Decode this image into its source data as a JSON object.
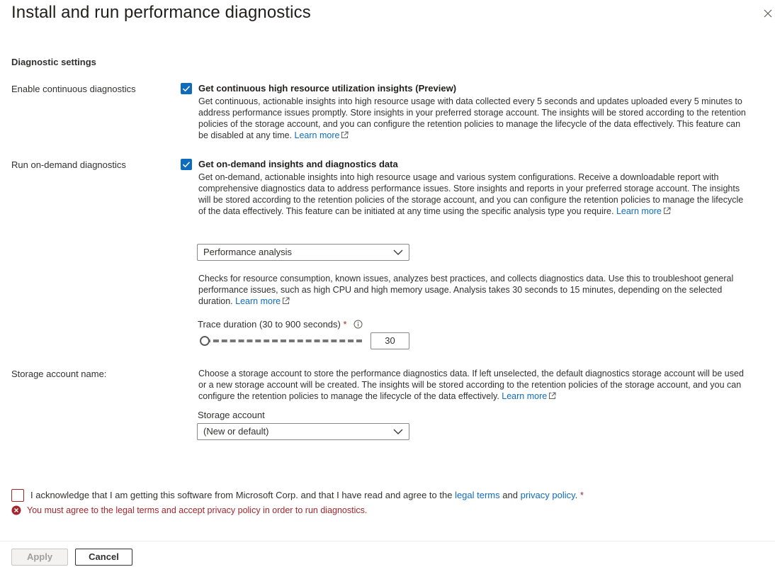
{
  "header": {
    "title": "Install and run performance diagnostics"
  },
  "section": {
    "title": "Diagnostic settings"
  },
  "continuous": {
    "label": "Enable continuous diagnostics",
    "checked": true,
    "option_title": "Get continuous high resource utilization insights (Preview)",
    "description": "Get continuous, actionable insights into high resource usage with data collected every 5 seconds and updates uploaded every 5 minutes to address performance issues promptly. Store insights in your preferred storage account. The insights will be stored according to the retention policies of the storage account, and you can configure the retention policies to manage the lifecycle of the data effectively. This feature can be disabled at any time.",
    "learn_more": "Learn more"
  },
  "ondemand": {
    "label": "Run on-demand diagnostics",
    "checked": true,
    "option_title": "Get on-demand insights and diagnostics data",
    "description": "Get on-demand, actionable insights into high resource usage and various system configurations. Receive a downloadable report with comprehensive diagnostics data to address performance issues. Store insights and reports in your preferred storage account. The insights will be stored according to the retention policies of the storage account, and you can configure the retention policies to manage the lifecycle of the data effectively. This feature can be initiated at any time using the specific analysis type you require.",
    "learn_more_1": "Learn",
    "learn_more_2": "more",
    "analysis_type": "Performance analysis",
    "analysis_description": "Checks for resource consumption, known issues, analyzes best practices, and collects diagnostics data. Use this to troubleshoot general performance issues, such as high CPU and high memory usage. Analysis takes 30 seconds to 15 minutes, depending on the selected duration.",
    "analysis_learn_more": "Learn more",
    "trace_label": "Trace duration (30 to 900 seconds)",
    "trace_required": "*",
    "trace_value": "30",
    "trace_min": 30,
    "trace_max": 900
  },
  "storage": {
    "label": "Storage account name:",
    "description": "Choose a storage account to store the performance diagnostics data. If left unselected, the default diagnostics storage account will be used or a new storage account will be created. The insights will be stored according to the retention policies of the storage account, and you can configure the retention policies to manage the lifecycle of the data effectively.",
    "learn_more": "Learn more",
    "field_label": "Storage account",
    "value": "(New or default)"
  },
  "acknowledge": {
    "checked": false,
    "text_before": "I acknowledge that I am getting this software from Microsoft Corp. and that I have read and agree to the",
    "legal_terms": "legal terms",
    "and": "and",
    "privacy_policy": "privacy policy",
    "suffix": ".",
    "required": "*",
    "error": "You must agree to the legal terms and accept privacy policy in order to run diagnostics."
  },
  "footer": {
    "apply": "Apply",
    "cancel": "Cancel"
  },
  "colors": {
    "accent": "#0f6cbd",
    "error": "#a4262c",
    "text": "#323130"
  }
}
